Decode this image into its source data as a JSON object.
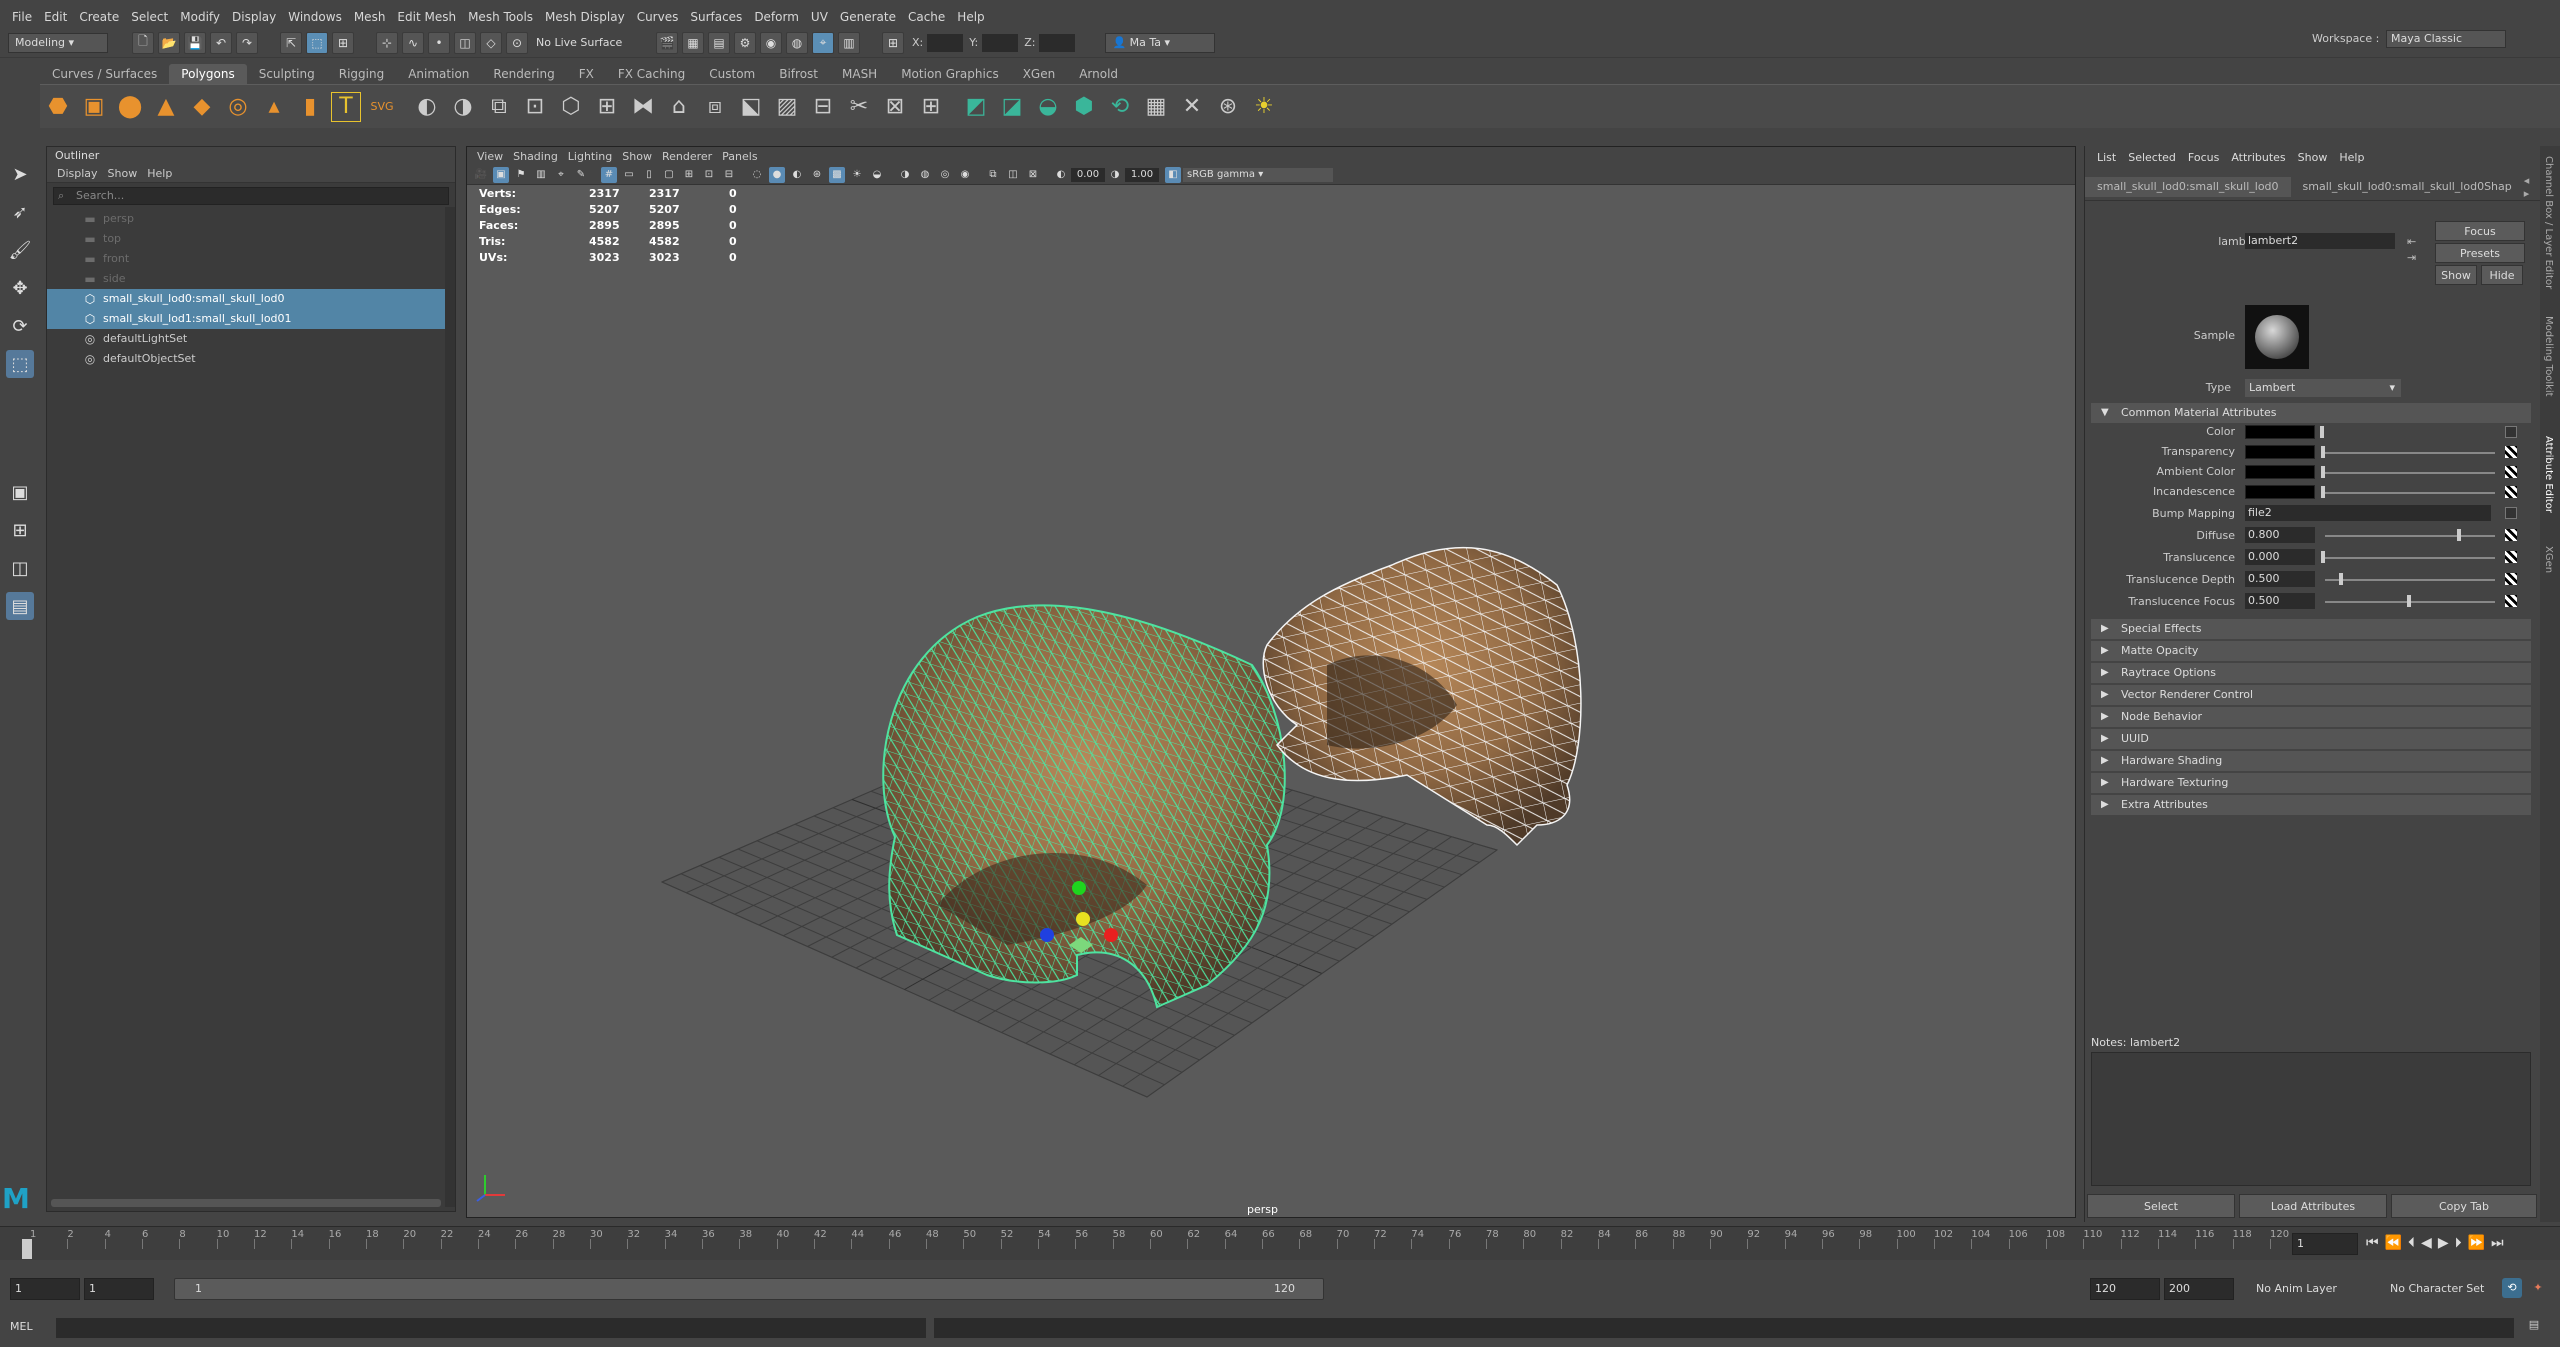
{
  "menubar": {
    "items": [
      "File",
      "Edit",
      "Create",
      "Select",
      "Modify",
      "Display",
      "Windows",
      "Mesh",
      "Edit Mesh",
      "Mesh Tools",
      "Mesh Display",
      "Curves",
      "Surfaces",
      "Deform",
      "UV",
      "Generate",
      "Cache",
      "Help"
    ],
    "workspace_label": "Workspace :",
    "workspace_value": "Maya Classic"
  },
  "status": {
    "mode": "Modeling",
    "live_surface": "No Live Surface",
    "x_label": "X:",
    "y_label": "Y:",
    "z_label": "Z:",
    "user": "Ma Ta"
  },
  "shelf": {
    "tabs": [
      "Curves / Surfaces",
      "Polygons",
      "Sculpting",
      "Rigging",
      "Animation",
      "Rendering",
      "FX",
      "FX Caching",
      "Custom",
      "Bifrost",
      "MASH",
      "Motion Graphics",
      "XGen",
      "Arnold"
    ],
    "active": "Polygons"
  },
  "outliner": {
    "title": "Outliner",
    "menu": [
      "Display",
      "Show",
      "Help"
    ],
    "search_placeholder": "Search...",
    "items": [
      {
        "label": "persp",
        "dim": true
      },
      {
        "label": "top",
        "dim": true
      },
      {
        "label": "front",
        "dim": true
      },
      {
        "label": "side",
        "dim": true
      },
      {
        "label": "small_skull_lod0:small_skull_lod0",
        "sel": true
      },
      {
        "label": "small_skull_lod1:small_skull_lod01",
        "sel": true
      },
      {
        "label": "defaultLightSet"
      },
      {
        "label": "defaultObjectSet"
      }
    ]
  },
  "viewport": {
    "menu": [
      "View",
      "Shading",
      "Lighting",
      "Show",
      "Renderer",
      "Panels"
    ],
    "exposure": "0.00",
    "gamma": "1.00",
    "color_space": "sRGB gamma",
    "camera": "persp",
    "hud": [
      {
        "label": "Verts:",
        "a": "2317",
        "b": "2317",
        "c": "0"
      },
      {
        "label": "Edges:",
        "a": "5207",
        "b": "5207",
        "c": "0"
      },
      {
        "label": "Faces:",
        "a": "2895",
        "b": "2895",
        "c": "0"
      },
      {
        "label": "Tris:",
        "a": "4582",
        "b": "4582",
        "c": "0"
      },
      {
        "label": "UVs:",
        "a": "3023",
        "b": "3023",
        "c": "0"
      }
    ]
  },
  "attr": {
    "menu": [
      "List",
      "Selected",
      "Focus",
      "Attributes",
      "Show",
      "Help"
    ],
    "tabs": [
      "small_skull_lod0:small_skull_lod0",
      "small_skull_lod0:small_skull_lod0Shap"
    ],
    "material_label": "lambert:",
    "material_name": "lambert2",
    "focus": "Focus",
    "presets": "Presets",
    "show": "Show",
    "hide": "Hide",
    "sample": "Sample",
    "type_label": "Type",
    "type_value": "Lambert",
    "common": "Common Material Attributes",
    "color": "Color",
    "transparency": "Transparency",
    "ambient": "Ambient Color",
    "incand": "Incandescence",
    "bump": "Bump Mapping",
    "bump_value": "file2",
    "diffuse": "Diffuse",
    "diffuse_value": "0.800",
    "transl": "Translucence",
    "transl_value": "0.000",
    "tdepth": "Translucence Depth",
    "tdepth_value": "0.500",
    "tfocus": "Translucence Focus",
    "tfocus_value": "0.500",
    "sections": [
      "Special Effects",
      "Matte Opacity",
      "Raytrace Options",
      "Vector Renderer Control",
      "Node Behavior",
      "UUID",
      "Hardware Shading",
      "Hardware Texturing",
      "Extra Attributes"
    ],
    "notes": "Notes: lambert2",
    "buttons": {
      "select": "Select",
      "load": "Load Attributes",
      "copy": "Copy Tab"
    },
    "side_tabs": [
      "Channel Box / Layer Editor",
      "Modeling Toolkit",
      "Attribute Editor",
      "XGen"
    ]
  },
  "timeline": {
    "ticks": [
      "1",
      "2",
      "4",
      "6",
      "8",
      "10",
      "12",
      "14",
      "16",
      "18",
      "20",
      "22",
      "24",
      "26",
      "28",
      "30",
      "32",
      "34",
      "36",
      "38",
      "40",
      "42",
      "44",
      "46",
      "48",
      "50",
      "52",
      "54",
      "56",
      "58",
      "60",
      "62",
      "64",
      "66",
      "68",
      "70",
      "72",
      "74",
      "76",
      "78",
      "80",
      "82",
      "84",
      "86",
      "88",
      "90",
      "92",
      "94",
      "96",
      "98",
      "100",
      "102",
      "104",
      "106",
      "108",
      "110",
      "112",
      "114",
      "116",
      "118",
      "120"
    ],
    "current": "1"
  },
  "range": {
    "start": "1",
    "start2": "1",
    "bar_start": "1",
    "bar_end": "120",
    "end": "120",
    "end2": "200",
    "anim_layer": "No Anim Layer",
    "char_set": "No Character Set"
  },
  "cmd": {
    "label": "MEL"
  },
  "icons": {
    "logo": "maya-logo-icon"
  },
  "colors": {
    "accent": "#5285a6",
    "wire_selected": "#4ee3a0",
    "bg": "#444444"
  }
}
